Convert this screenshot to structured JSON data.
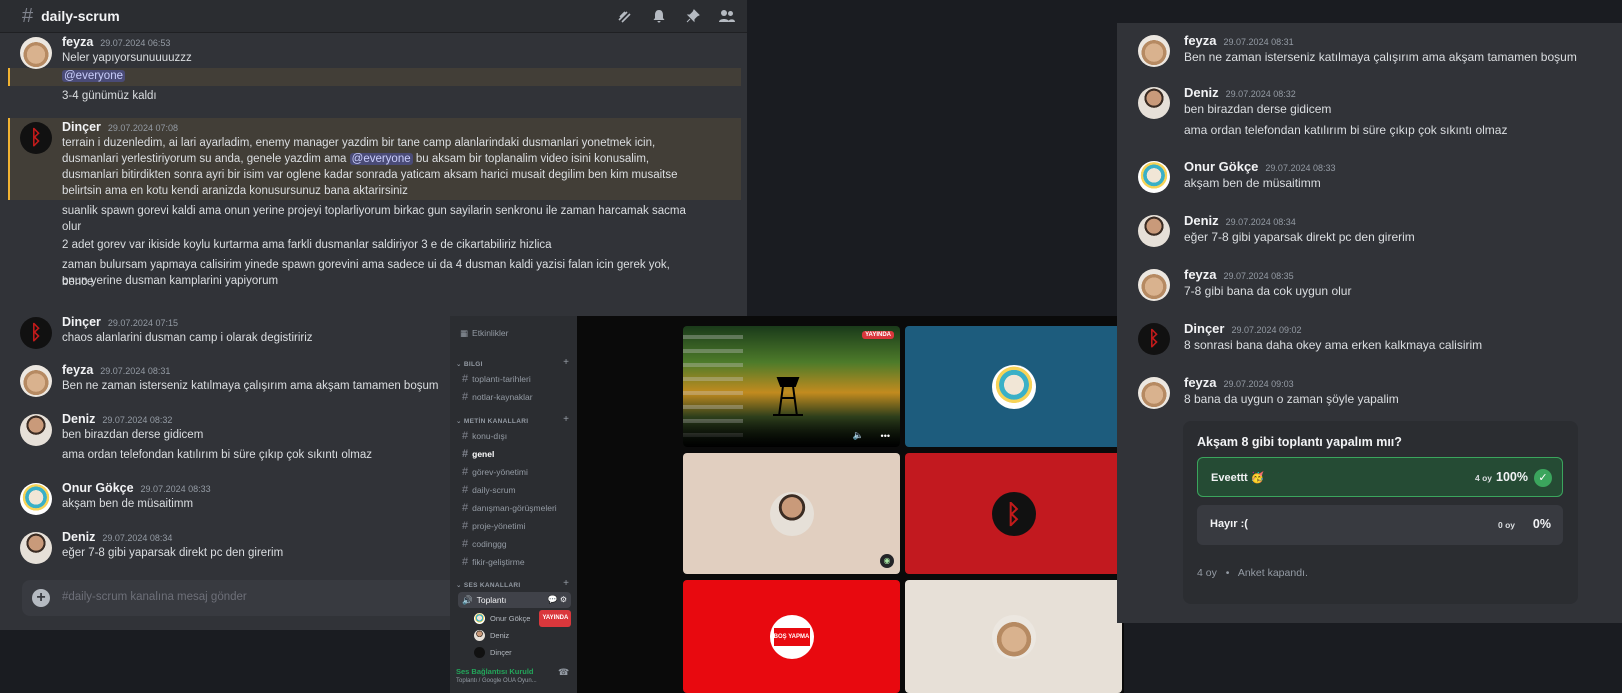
{
  "colors": {
    "accent_mention": "#5865f2",
    "highlight_border": "#f0b232",
    "live_red": "#da373c",
    "poll_win": "#3ba55d"
  },
  "panel_a": {
    "channel_name": "daily-scrum",
    "toolbar_icons": [
      "threads-icon",
      "bell-icon",
      "pin-icon",
      "members-icon"
    ],
    "messages": [
      {
        "user": "feyza",
        "time": "29.07.2024 06:53",
        "lines": [
          "Neler yapıyorsunuuuuzzz",
          "@everyone",
          "3-4 günümüz kaldı"
        ]
      },
      {
        "user": "Dinçer",
        "time": "29.07.2024 07:08",
        "p1": "terrain i duzenledim, ai lari ayarladim, enemy manager yazdim bir tane camp alanlarindaki dusmanlari yonetmek icin,",
        "p2a": "dusmanlari yerlestiriyorum su anda, genele yazdim ama",
        "p2_mention": "@everyone",
        "p2b": "bu aksam bir toplanalim video isini konusalim,",
        "p3": "dusmanlari bitirdikten sonra ayri bir isim var oglene kadar sonrada yaticam aksam harici musait degilim ben kim musaitse",
        "p4": "belirtsin ama en kotu kendi aranizda konusursunuz bana aktarirsiniz",
        "p5": "suanlik spawn gorevi kaldi ama onun yerine projeyi toplarliyorum birkac gun sayilarin senkronu ile zaman harcamak sacma",
        "p6": "olur",
        "p7": "2 adet gorev var ikiside koylu kurtarma ama farkli dusmanlar saldiriyor 3 e de cikartabiliriz hizlica",
        "p8": "zaman bulursam yapmaya calisirim yinede spawn gorevini ama sadece ui da 4 dusman kaldi yazisi falan icin gerek yok, bence",
        "p9": "onun yerine dusman kamplarini yapiyorum"
      },
      {
        "user": "Dinçer",
        "time": "29.07.2024 07:15",
        "lines": [
          "chaos alanlarini dusman camp i olarak degistiririz"
        ]
      },
      {
        "user": "feyza",
        "time": "29.07.2024 08:31",
        "lines": [
          "Ben ne zaman isterseniz katılmaya çalışırım ama akşam tamamen boşum"
        ]
      },
      {
        "user": "Deniz",
        "time": "29.07.2024 08:32",
        "lines": [
          "ben birazdan derse gidicem",
          "ama ordan telefondan katılırım bi süre çıkıp çok sıkıntı olmaz"
        ]
      },
      {
        "user": "Onur Gökçe",
        "time": "29.07.2024 08:33",
        "lines": [
          "akşam ben de müsaitimm"
        ]
      },
      {
        "user": "Deniz",
        "time": "29.07.2024 08:34",
        "lines": [
          "eğer 7-8 gibi yaparsak direkt pc den girerim"
        ]
      }
    ],
    "input_placeholder": "#daily-scrum kanalına mesaj gönder"
  },
  "panel_b": {
    "events_label": "Etkinlikler",
    "cat_bilgi": "BILGI",
    "bilgi_channels": [
      "toplantı-tarihleri",
      "notlar-kaynaklar"
    ],
    "cat_metin": "METİN KANALLARI",
    "text_channels": [
      "konu-dışı",
      "genel",
      "görev-yönetimi",
      "daily-scrum",
      "danışman-görüşmeleri",
      "proje-yönetimi",
      "codinggg",
      "fikir-geliştirme"
    ],
    "cat_ses": "SES KANALLARI",
    "voice_channel": "Toplantı",
    "voice_users": [
      "Onur Gökçe",
      "Deniz",
      "Dinçer"
    ],
    "live_badge": "YAYINDA",
    "connection_status": "Ses Bağlantısı Kuruld",
    "connection_sub": "Toplantı / Google OUA Oyun...",
    "screen_live_badge": "YAYINDA",
    "tile_label_stop": "BOŞ YAPMA"
  },
  "panel_c": {
    "messages": [
      {
        "user": "feyza",
        "time": "29.07.2024 08:31",
        "lines": [
          "Ben ne zaman isterseniz katılmaya çalışırım ama akşam tamamen boşum"
        ]
      },
      {
        "user": "Deniz",
        "time": "29.07.2024 08:32",
        "lines": [
          "ben birazdan derse gidicem",
          "ama ordan telefondan katılırım bi süre çıkıp çok sıkıntı olmaz"
        ]
      },
      {
        "user": "Onur Gökçe",
        "time": "29.07.2024 08:33",
        "lines": [
          "akşam ben de müsaitimm"
        ]
      },
      {
        "user": "Deniz",
        "time": "29.07.2024 08:34",
        "lines": [
          "eğer 7-8 gibi yaparsak direkt pc den girerim"
        ]
      },
      {
        "user": "feyza",
        "time": "29.07.2024 08:35",
        "lines": [
          "7-8 gibi bana da cok uygun olur"
        ]
      },
      {
        "user": "Dinçer",
        "time": "29.07.2024 09:02",
        "lines": [
          "8 sonrasi bana daha okey ama erken kalkmaya calisirim"
        ]
      },
      {
        "user": "feyza",
        "time": "29.07.2024 09:03",
        "lines": [
          "8 bana da uygun o zaman şöyle yapalim"
        ]
      }
    ],
    "poll": {
      "question": "Akşam 8 gibi toplantı yapalım mıı?",
      "options": [
        {
          "label": "Eveettt 🥳",
          "votes": "4 oy",
          "percent": "100%",
          "fraction": 1.0
        },
        {
          "label": "Hayır :(",
          "votes": "0 oy",
          "percent": "0%",
          "fraction": 0.0
        }
      ],
      "total": "4 oy",
      "sep": "•",
      "status": "Anket kapandı."
    }
  }
}
